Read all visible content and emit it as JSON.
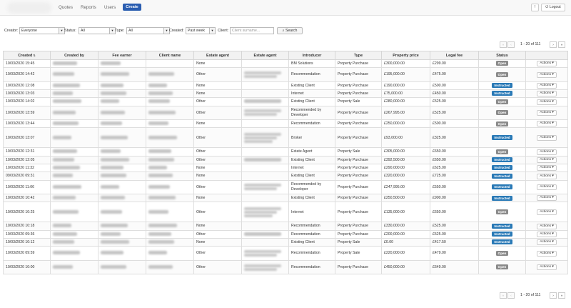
{
  "nav": {
    "links": [
      "Quotes",
      "Reports",
      "Users"
    ],
    "create_label": "Create",
    "help_label": "!",
    "logout_label": "Logout"
  },
  "filters": {
    "creator_label": "Creator:",
    "creator_value": "Everyone",
    "status_label": "Status:",
    "status_value": "All",
    "type_label": "Type:",
    "type_value": "All",
    "created_label": "Created:",
    "created_value": "Past week",
    "client_label": "Client:",
    "client_placeholder": "Client surname...",
    "search_label": "Search"
  },
  "pagination": {
    "text": "1 - 20 of 111",
    "first": "«",
    "prev": "‹",
    "next": "›",
    "last": "»"
  },
  "table": {
    "headers": [
      "Created",
      "Created by",
      "Fee earner",
      "Client name",
      "Estate agent",
      "Estate agent",
      "Introducer",
      "Type",
      "Property price",
      "Legal fee",
      "Status",
      ""
    ],
    "actions_label": "Actions",
    "rows": [
      {
        "created": "10/03/2020 15:45",
        "agent": "None",
        "introducer": "BM Solutions",
        "type": "Property Purchase",
        "price": "£300,000.00",
        "fee": "£299.00",
        "status": "Open",
        "h": 1,
        "by": 1,
        "fe": 1,
        "cn": 0,
        "ea2": 0
      },
      {
        "created": "10/03/2020 14:42",
        "agent": "Other",
        "introducer": "Recommendation",
        "type": "Property Purchase",
        "price": "£195,000.00",
        "fee": "£475.00",
        "status": "Open",
        "h": 2,
        "by": 1,
        "fe": 1,
        "cn": 1,
        "ea2": 2
      },
      {
        "created": "10/03/2020 12:08",
        "agent": "None",
        "introducer": "Existing Client",
        "type": "Property Purchase",
        "price": "£190,000.00",
        "fee": "£500.00",
        "status": "Instructed",
        "h": 1,
        "by": 1,
        "fe": 1,
        "cn": 1,
        "ea2": 0
      },
      {
        "created": "10/03/2020 13:03",
        "agent": "None",
        "introducer": "Internet",
        "type": "Property Purchase",
        "price": "£75,000.00",
        "fee": "£450.00",
        "status": "Instructed",
        "h": 1,
        "by": 1,
        "fe": 1,
        "cn": 1,
        "ea2": 0
      },
      {
        "created": "10/03/2020 14:02",
        "agent": "Other",
        "introducer": "Existing Client",
        "type": "Property Sale",
        "price": "£280,000.00",
        "fee": "£525.00",
        "status": "Open",
        "h": 1,
        "by": 1,
        "fe": 1,
        "cn": 1,
        "ea2": 1
      },
      {
        "created": "10/03/2020 13:59",
        "agent": "Other",
        "introducer": "Recommended by Developer",
        "type": "Property Purchase",
        "price": "£267,995.00",
        "fee": "£525.00",
        "status": "Open",
        "h": 2,
        "by": 1,
        "fe": 1,
        "cn": 1,
        "ea2": 2
      },
      {
        "created": "10/03/2020 13:44",
        "agent": "None",
        "introducer": "Recommendation",
        "type": "Property Purchase",
        "price": "£250,000.00",
        "fee": "£500.00",
        "status": "Open",
        "h": 1,
        "by": 1,
        "fe": 1,
        "cn": 1,
        "ea2": 0
      },
      {
        "created": "10/03/2020 13:07",
        "agent": "Other",
        "introducer": "Broker",
        "type": "Property Purchase",
        "price": "£93,000.00",
        "fee": "£325.00",
        "status": "Instructed",
        "h": 3,
        "by": 1,
        "fe": 1,
        "cn": 1,
        "ea2": 3
      },
      {
        "created": "10/03/2020 12:31",
        "agent": "Other",
        "introducer": "Estate Agent",
        "type": "Property Sale",
        "price": "£305,000.00",
        "fee": "£650.00",
        "status": "Open",
        "h": 1,
        "by": 1,
        "fe": 1,
        "cn": 1,
        "ea2": 0
      },
      {
        "created": "10/03/2020 12:05",
        "agent": "Other",
        "introducer": "Existing Client",
        "type": "Property Purchase",
        "price": "£392,500.00",
        "fee": "£650.00",
        "status": "Instructed",
        "h": 1,
        "by": 1,
        "fe": 1,
        "cn": 1,
        "ea2": 1
      },
      {
        "created": "10/03/2020 11:32",
        "agent": "None",
        "introducer": "Internet",
        "type": "Property Purchase",
        "price": "£290,000.00",
        "fee": "£625.00",
        "status": "Instructed",
        "h": 1,
        "by": 1,
        "fe": 1,
        "cn": 1,
        "ea2": 0
      },
      {
        "created": "09/03/2020 09:31",
        "agent": "None",
        "introducer": "Existing Client",
        "type": "Property Purchase",
        "price": "£320,000.00",
        "fee": "£725.00",
        "status": "Instructed",
        "h": 1,
        "by": 1,
        "fe": 1,
        "cn": 1,
        "ea2": 0
      },
      {
        "created": "10/03/2020 11:06",
        "agent": "Other",
        "introducer": "Recommended by Developer",
        "type": "Property Purchase",
        "price": "£247,995.00",
        "fee": "£550.00",
        "status": "Instructed",
        "h": 2,
        "by": 1,
        "fe": 1,
        "cn": 1,
        "ea2": 2
      },
      {
        "created": "10/03/2020 10:42",
        "agent": "None",
        "introducer": "Existing Client",
        "type": "Property Purchase",
        "price": "£250,500.00",
        "fee": "£900.00",
        "status": "Instructed",
        "h": 1,
        "by": 1,
        "fe": 1,
        "cn": 1,
        "ea2": 0
      },
      {
        "created": "10/03/2020 10:25",
        "agent": "Other",
        "introducer": "Internet",
        "type": "Property Purchase",
        "price": "£135,000.00",
        "fee": "£650.00",
        "status": "Open",
        "h": 3,
        "by": 1,
        "fe": 1,
        "cn": 1,
        "ea2": 3
      },
      {
        "created": "10/03/2020 10:18",
        "agent": "None",
        "introducer": "Recommendation",
        "type": "Property Purchase",
        "price": "£330,000.00",
        "fee": "£525.00",
        "status": "Instructed",
        "h": 1,
        "by": 1,
        "fe": 1,
        "cn": 1,
        "ea2": 0
      },
      {
        "created": "10/03/2020 09:36",
        "agent": "Other",
        "introducer": "Recommendation",
        "type": "Property Purchase",
        "price": "£200,000.00",
        "fee": "£525.00",
        "status": "Instructed",
        "h": 1,
        "by": 1,
        "fe": 1,
        "cn": 1,
        "ea2": 1
      },
      {
        "created": "10/03/2020 10:12",
        "agent": "None",
        "introducer": "Existing Client",
        "type": "Property Sale",
        "price": "£0.00",
        "fee": "£417.50",
        "status": "Instructed",
        "h": 1,
        "by": 1,
        "fe": 1,
        "cn": 1,
        "ea2": 0
      },
      {
        "created": "10/03/2020 09:59",
        "agent": "Other",
        "introducer": "Recommendation",
        "type": "Property Sale",
        "price": "£220,000.00",
        "fee": "£479.00",
        "status": "Open",
        "h": 2,
        "by": 1,
        "fe": 1,
        "cn": 1,
        "ea2": 2
      },
      {
        "created": "10/03/2020 10:00",
        "agent": "Other",
        "introducer": "Recommendation",
        "type": "Property Purchase",
        "price": "£450,000.00",
        "fee": "£649.00",
        "status": "Open",
        "h": 2,
        "by": 1,
        "fe": 1,
        "cn": 1,
        "ea2": 2
      }
    ]
  },
  "colors": {
    "create": "#2a5db0",
    "instructed": "#2979b6",
    "open": "#8a8a8a"
  }
}
